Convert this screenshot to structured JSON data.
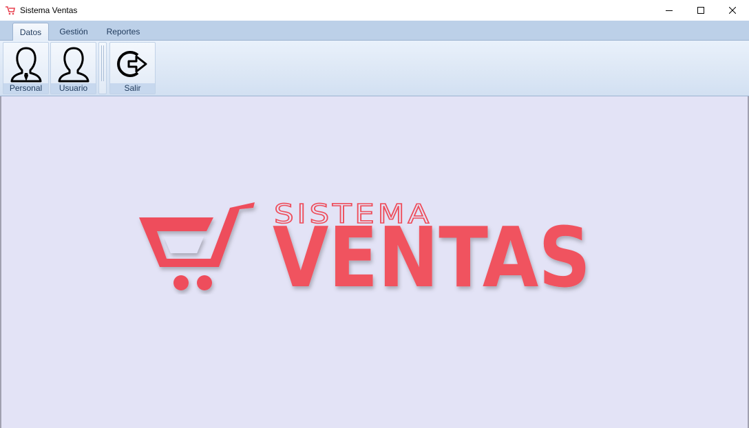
{
  "window": {
    "title": "Sistema Ventas",
    "icon": "cart-icon",
    "controls": [
      "minimize-icon",
      "maximize-icon",
      "close-icon"
    ]
  },
  "tabs": [
    {
      "label": "Datos",
      "active": true
    },
    {
      "label": "Gestión",
      "active": false
    },
    {
      "label": "Reportes",
      "active": false
    }
  ],
  "ribbon": {
    "buttons": [
      {
        "label": "Personal",
        "icon": "user-tie-icon"
      },
      {
        "label": "Usuario",
        "icon": "user-icon"
      },
      {
        "label": "Salir",
        "icon": "exit-icon"
      }
    ]
  },
  "logo": {
    "line1": "SISTEMA",
    "line2": "VENTAS",
    "icon": "shopping-cart-icon"
  },
  "colors": {
    "accent": "#f0535f",
    "client_bg": "#e3e3f6",
    "ribbon_text": "#1e395b"
  }
}
